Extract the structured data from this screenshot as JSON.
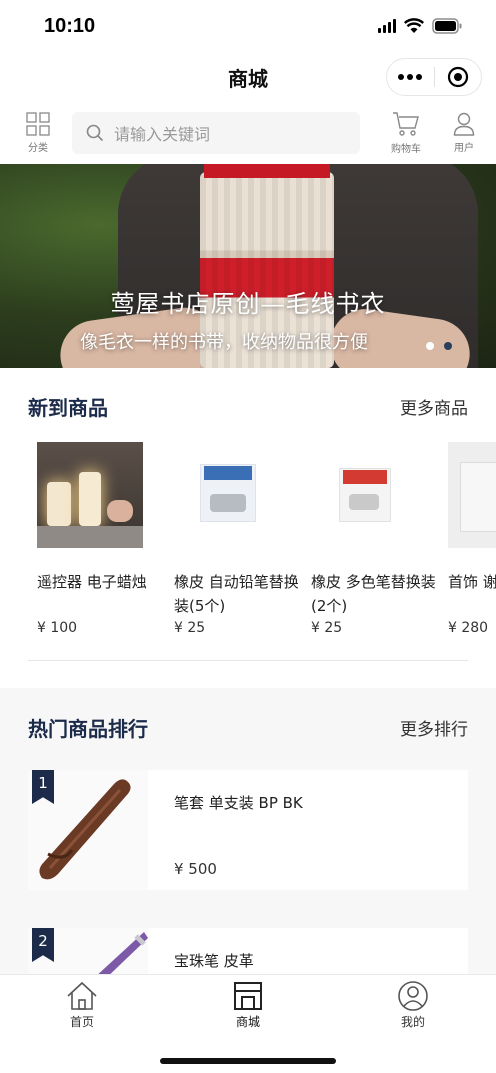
{
  "status": {
    "time": "10:10"
  },
  "nav": {
    "title": "商城"
  },
  "toolbar": {
    "category_label": "分类",
    "search_placeholder": "请输入关键词",
    "cart_label": "购物车",
    "user_label": "用户"
  },
  "banner": {
    "title": "莺屋书店原创—毛线书衣",
    "subtitle": "像毛衣一样的书带，收纳物品很方便",
    "active_dot": 1,
    "dot_count": 2
  },
  "new_products": {
    "title": "新到商品",
    "more": "更多商品",
    "items": [
      {
        "name": "遥控器 电子蜡烛",
        "price": "¥ 100"
      },
      {
        "name": "橡皮 自动铅笔替换装(5个)",
        "price": "¥ 25"
      },
      {
        "name": "橡皮 多色笔替换装(2个)",
        "price": "¥ 25"
      },
      {
        "name": "首饰 谢谢",
        "price": "¥ 280"
      }
    ]
  },
  "hot_products": {
    "title": "热门商品排行",
    "more": "更多排行",
    "items": [
      {
        "rank": "1",
        "name": "笔套 单支装 BP BK",
        "price": "¥ 500"
      },
      {
        "rank": "2",
        "name": "宝珠笔 皮革",
        "price": ""
      }
    ]
  },
  "tabbar": {
    "items": [
      {
        "label": "首页"
      },
      {
        "label": "商城"
      },
      {
        "label": "我的"
      }
    ],
    "active": 1
  },
  "colors": {
    "accent": "#1c2b4a",
    "banner_red": "#cf1f2b"
  }
}
